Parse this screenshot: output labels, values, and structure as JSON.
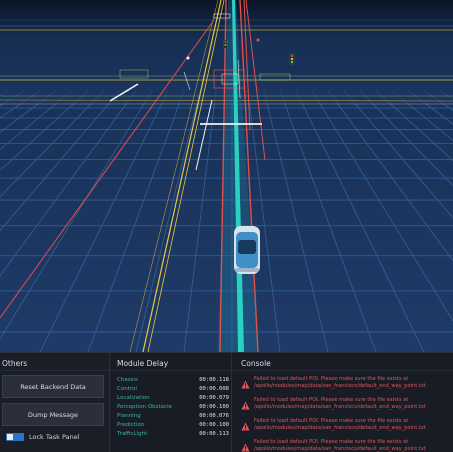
{
  "scene": {
    "colors": {
      "background": "#1e3660",
      "grid": "#3d6fb0",
      "lane_center": "#2ad1c2",
      "lane_edge_red": "#e0504c",
      "lane_edge_yellow": "#e8c840",
      "lane_line_white": "#f2f2f2",
      "ego_vehicle": "#3f8fc8"
    },
    "icons": [
      "ego-vehicle",
      "traffic-light",
      "stop-line"
    ]
  },
  "task_panel": {
    "others": {
      "title": "Others",
      "reset_label": "Reset Backend Data",
      "dump_label": "Dump Message",
      "lock_label": "Lock Task Panel",
      "lock_enabled": true
    },
    "module_delay": {
      "title": "Module Delay",
      "rows": [
        {
          "name": "Chassis",
          "value": "00:00.118"
        },
        {
          "name": "Control",
          "value": "00:00.008"
        },
        {
          "name": "Localization",
          "value": "00:00.079"
        },
        {
          "name": "Perception Obstacle",
          "value": "00:00.100"
        },
        {
          "name": "Planning",
          "value": "00:00.076"
        },
        {
          "name": "Prediction",
          "value": "00:00.100"
        },
        {
          "name": "TrafficLight",
          "value": "00:00.113"
        }
      ]
    },
    "console": {
      "title": "Console",
      "messages": [
        "Failed to load default POI. Please make sure the file exists at\n/apollo/modules/map/data/san_francisco/default_end_way_point.txt",
        "Failed to load default POI. Please make sure the file exists at\n/apollo/modules/map/data/san_francisco/default_end_way_point.txt",
        "Failed to load default POI. Please make sure the file exists at\n/apollo/modules/map/data/san_francisco/default_end_way_point.txt",
        "Failed to load default POI. Please make sure the file exists at\n/apollo/modules/map/data/san_francisco/default_end_way_point.txt"
      ]
    }
  }
}
